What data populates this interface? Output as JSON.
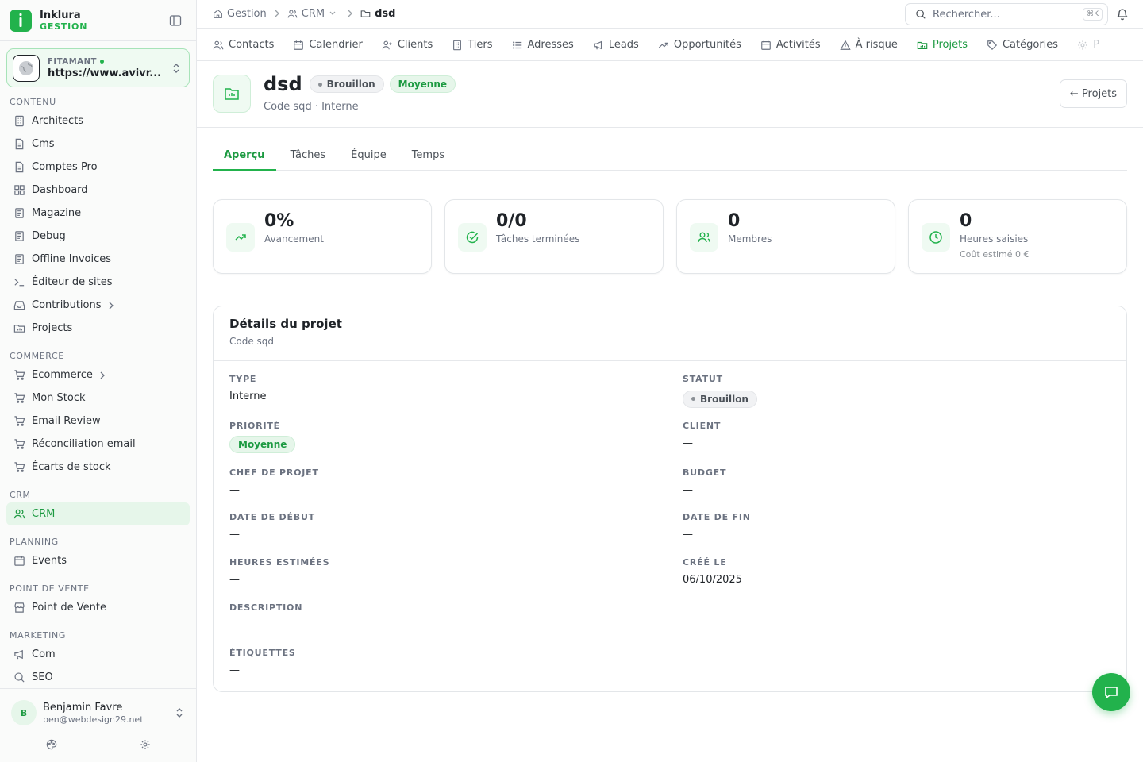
{
  "brand": {
    "name": "Inklura",
    "sub": "GESTION"
  },
  "site": {
    "label": "FITAMANT",
    "url": "https://www.avivr..."
  },
  "sidebar": {
    "sections": [
      {
        "title": "CONTENU",
        "items": [
          {
            "label": "Architects",
            "icon": "building-icon"
          },
          {
            "label": "Cms",
            "icon": "document-icon"
          },
          {
            "label": "Comptes Pro",
            "icon": "document-icon"
          },
          {
            "label": "Dashboard",
            "icon": "grid-icon"
          },
          {
            "label": "Magazine",
            "icon": "newspaper-icon"
          },
          {
            "label": "Debug",
            "icon": "newspaper-icon"
          },
          {
            "label": "Offline Invoices",
            "icon": "newspaper-icon"
          },
          {
            "label": "Éditeur de sites",
            "icon": "terminal-icon"
          },
          {
            "label": "Contributions",
            "icon": "inbox-icon",
            "chevron": true
          },
          {
            "label": "Projects",
            "icon": "folder-icon"
          }
        ]
      },
      {
        "title": "COMMERCE",
        "items": [
          {
            "label": "Ecommerce",
            "icon": "cart-icon",
            "chevron": true
          },
          {
            "label": "Mon Stock",
            "icon": "cart-icon"
          },
          {
            "label": "Email Review",
            "icon": "cart-icon"
          },
          {
            "label": "Réconciliation email",
            "icon": "cart-icon"
          },
          {
            "label": "Écarts de stock",
            "icon": "cart-icon"
          }
        ]
      },
      {
        "title": "CRM",
        "items": [
          {
            "label": "CRM",
            "icon": "users-icon",
            "active": true
          }
        ]
      },
      {
        "title": "PLANNING",
        "items": [
          {
            "label": "Events",
            "icon": "calendar-icon"
          }
        ]
      },
      {
        "title": "POINT DE VENTE",
        "items": [
          {
            "label": "Point de Vente",
            "icon": "store-icon"
          }
        ]
      },
      {
        "title": "MARKETING",
        "items": [
          {
            "label": "Com",
            "icon": "megaphone-icon"
          },
          {
            "label": "SEO",
            "icon": "search-icon"
          }
        ]
      }
    ]
  },
  "user": {
    "initial": "B",
    "name": "Benjamin Favre",
    "email": "ben@webdesign29.net"
  },
  "breadcrumb": {
    "home": "Gestion",
    "section": "CRM",
    "current": "dsd"
  },
  "search": {
    "placeholder": "Rechercher...",
    "shortcut": "⌘K"
  },
  "module_tabs": [
    {
      "label": "Contacts",
      "icon": "users-icon"
    },
    {
      "label": "Calendrier",
      "icon": "calendar-icon"
    },
    {
      "label": "Clients",
      "icon": "user-plus-icon"
    },
    {
      "label": "Tiers",
      "icon": "building-icon"
    },
    {
      "label": "Adresses",
      "icon": "list-icon"
    },
    {
      "label": "Leads",
      "icon": "megaphone-icon"
    },
    {
      "label": "Opportunités",
      "icon": "trend-icon"
    },
    {
      "label": "Activités",
      "icon": "calendar-icon"
    },
    {
      "label": "À risque",
      "icon": "warning-icon"
    },
    {
      "label": "Projets",
      "icon": "folder-icon",
      "active": true
    },
    {
      "label": "Catégories",
      "icon": "tag-icon"
    },
    {
      "label": "P",
      "icon": "gear-icon"
    }
  ],
  "project": {
    "name": "dsd",
    "status": "Brouillon",
    "priority": "Moyenne",
    "subtitle": "Code sqd · Interne",
    "back_label": "← Projets"
  },
  "content_tabs": [
    "Aperçu",
    "Tâches",
    "Équipe",
    "Temps"
  ],
  "stats": [
    {
      "value": "0%",
      "label": "Avancement",
      "icon": "trend-up-icon"
    },
    {
      "value": "0/0",
      "label": "Tâches terminées",
      "icon": "check-circle-icon"
    },
    {
      "value": "0",
      "label": "Membres",
      "icon": "users-icon"
    },
    {
      "value": "0",
      "label": "Heures saisies",
      "extra": "Coût estimé 0 €",
      "icon": "clock-icon"
    }
  ],
  "details": {
    "title": "Détails du projet",
    "subtitle": "Code sqd",
    "type_label": "TYPE",
    "type_value": "Interne",
    "status_label": "STATUT",
    "status_value": "Brouillon",
    "priority_label": "PRIORITÉ",
    "priority_value": "Moyenne",
    "client_label": "CLIENT",
    "client_value": "—",
    "manager_label": "CHEF DE PROJET",
    "manager_value": "—",
    "budget_label": "BUDGET",
    "budget_value": "—",
    "start_label": "DATE DE DÉBUT",
    "start_value": "—",
    "end_label": "DATE DE FIN",
    "end_value": "—",
    "hours_label": "HEURES ESTIMÉES",
    "hours_value": "—",
    "created_label": "CRÉÉ LE",
    "created_value": "06/10/2025",
    "description_label": "DESCRIPTION",
    "description_value": "—",
    "tags_label": "ÉTIQUETTES",
    "tags_value": "—"
  },
  "colors": {
    "accent": "#22b24c",
    "accent_dark": "#1c9a41",
    "accent_bg": "#e6f6ea"
  }
}
